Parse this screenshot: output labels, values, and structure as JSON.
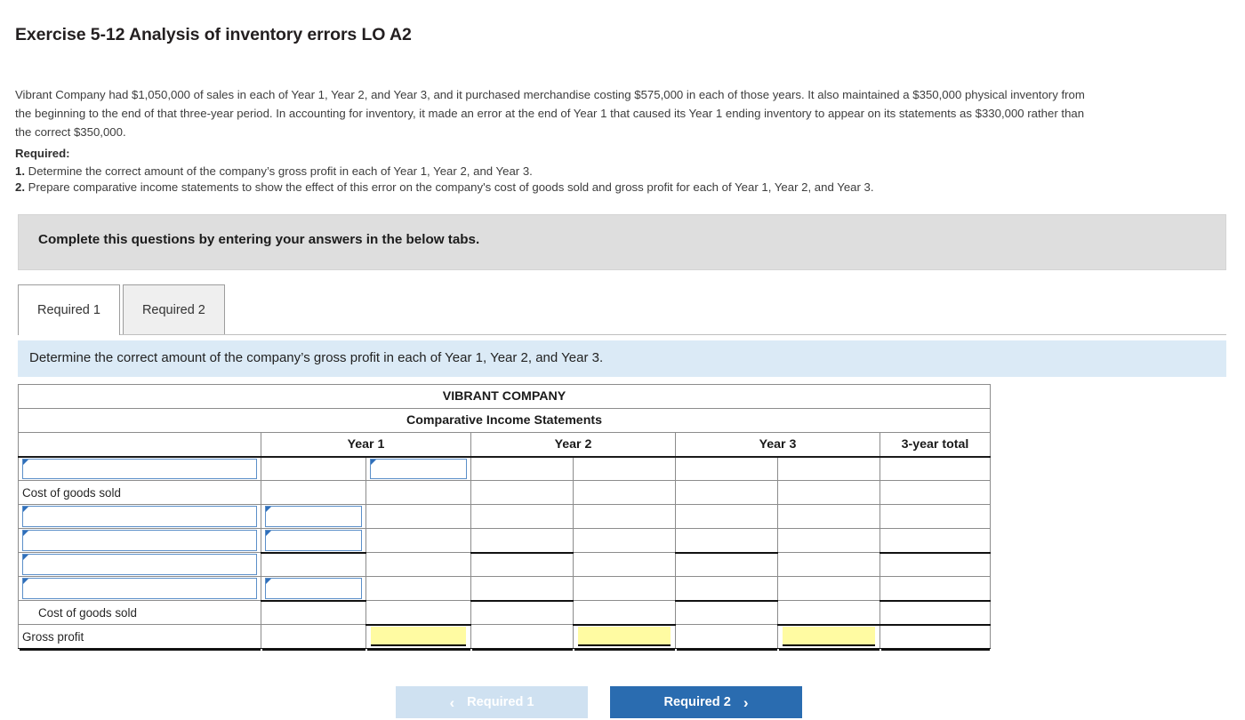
{
  "exercise": {
    "title": "Exercise 5-12 Analysis of inventory errors LO A2",
    "problem_text": "Vibrant Company had $1,050,000 of sales in each of Year 1, Year 2, and Year 3, and it purchased merchandise costing $575,000 in each of those years. It also maintained a $350,000 physical inventory from the beginning to the end of that three-year period. In accounting for inventory, it made an error at the end of Year 1 that caused its Year 1 ending inventory to appear on its statements as $330,000 rather than the correct $350,000.",
    "required_heading": "Required:",
    "requirements": [
      {
        "number": "1.",
        "text": "Determine the correct amount of the company’s gross profit in each of Year 1, Year 2, and Year 3."
      },
      {
        "number": "2.",
        "text": "Prepare comparative income statements to show the effect of this error on the company's cost of goods sold and gross profit for each of Year 1, Year 2, and Year 3."
      }
    ]
  },
  "callout": {
    "text": "Complete this questions by entering your answers in the below tabs."
  },
  "tabs": [
    {
      "label": "Required 1",
      "active": true
    },
    {
      "label": "Required 2",
      "active": false
    }
  ],
  "banner": {
    "text": "Determine the correct amount of the company’s gross profit in each of Year 1, Year 2, and Year 3."
  },
  "sheet": {
    "company": "VIBRANT COMPANY",
    "statement": "Comparative Income Statements",
    "columns": [
      "",
      "Year 1",
      "Year 2",
      "Year 3",
      "3-year total"
    ],
    "rows": [
      {
        "label": "",
        "label_type": "dropdown",
        "indent": false
      },
      {
        "label": "Cost of goods sold",
        "label_type": "text",
        "indent": false
      },
      {
        "label": "",
        "label_type": "dropdown",
        "indent": false
      },
      {
        "label": "",
        "label_type": "dropdown",
        "indent": false
      },
      {
        "label": "",
        "label_type": "dropdown",
        "indent": false
      },
      {
        "label": "",
        "label_type": "dropdown",
        "indent": false
      },
      {
        "label": "Cost of goods sold",
        "label_type": "text",
        "indent": true
      },
      {
        "label": "Gross profit",
        "label_type": "text",
        "indent": false
      }
    ]
  },
  "nav": {
    "prev_label": "Required 1",
    "next_label": "Required 2",
    "prev_chevron": "‹",
    "next_chevron": "›"
  },
  "colors": {
    "header_blue": "#7cb0e8",
    "banner_blue": "#dbeaf6",
    "callout_gray": "#dedede",
    "input_yellow": "#fffba2",
    "accent_blue": "#2a6cb0",
    "disabled_blue": "#cfe1f1"
  }
}
